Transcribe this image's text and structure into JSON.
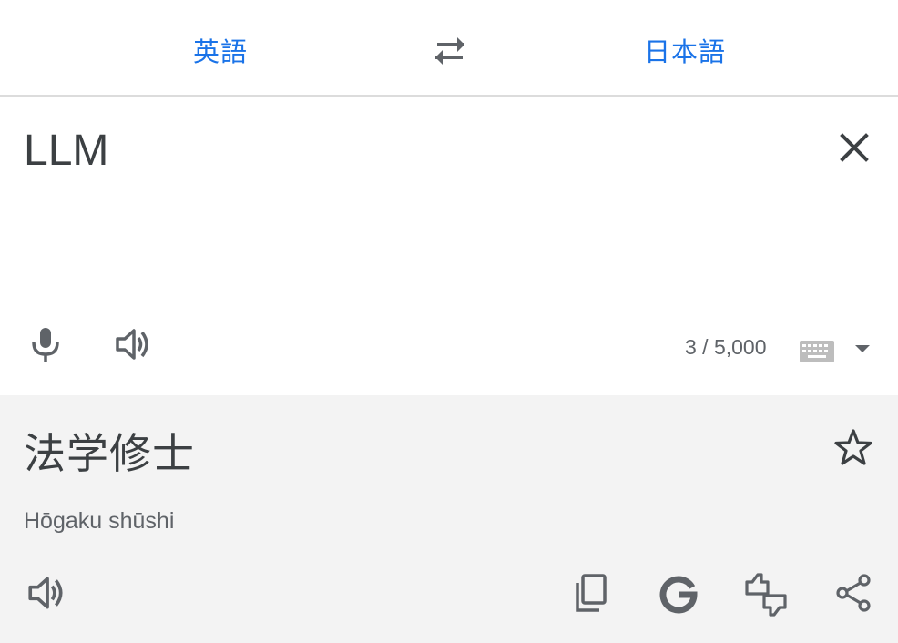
{
  "languages": {
    "source": "英語",
    "target": "日本語"
  },
  "input": {
    "text": "LLM",
    "char_count": "3 / 5,000"
  },
  "output": {
    "translation": "法学修士",
    "romanization": "Hōgaku shūshi"
  },
  "icons": {
    "swap": "swap-icon",
    "clear": "close-icon",
    "mic": "microphone-icon",
    "speaker": "speaker-icon",
    "keyboard": "keyboard-icon",
    "dropdown": "chevron-down-icon",
    "star": "star-icon",
    "copy": "copy-icon",
    "google": "google-icon",
    "feedback": "feedback-icon",
    "share": "share-icon"
  },
  "colors": {
    "accent": "#1a73e8",
    "icon": "#5f6368",
    "output_bg": "#f3f3f3"
  }
}
